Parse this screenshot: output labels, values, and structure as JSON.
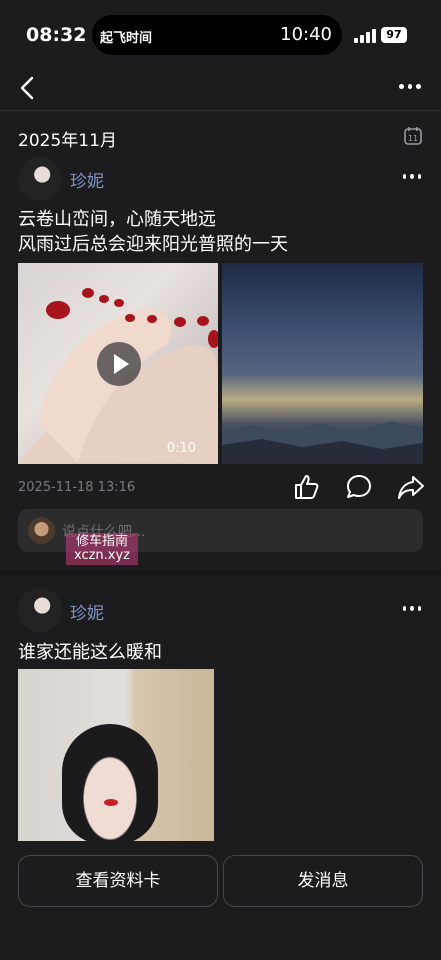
{
  "status_bar": {
    "time": "08:32",
    "island_app": "起飞时间",
    "island_time": "10:40",
    "battery": "97"
  },
  "nav": {
    "back_icon": "chevron-left-icon",
    "more_icon": "more-horizontal-icon"
  },
  "feed": {
    "month": "2025年11月",
    "posts": [
      {
        "user": "珍妮",
        "text_line1": "云卷山峦间，心随天地远",
        "text_line2": "风雨过后总会迎来阳光普照的一天",
        "video_duration": "0:10",
        "timestamp": "2025-11-18 13:16",
        "comment_placeholder": "说点什么吧..."
      },
      {
        "user": "珍妮",
        "text": "谁家还能这么暖和"
      }
    ]
  },
  "watermark": {
    "line1": "修车指南",
    "line2": "xczn.xyz"
  },
  "buttons": {
    "profile": "查看资料卡",
    "message": "发消息"
  },
  "colors": {
    "background": "#1c1c1e",
    "username": "#7e93c9",
    "divider": "#2e2e30"
  }
}
